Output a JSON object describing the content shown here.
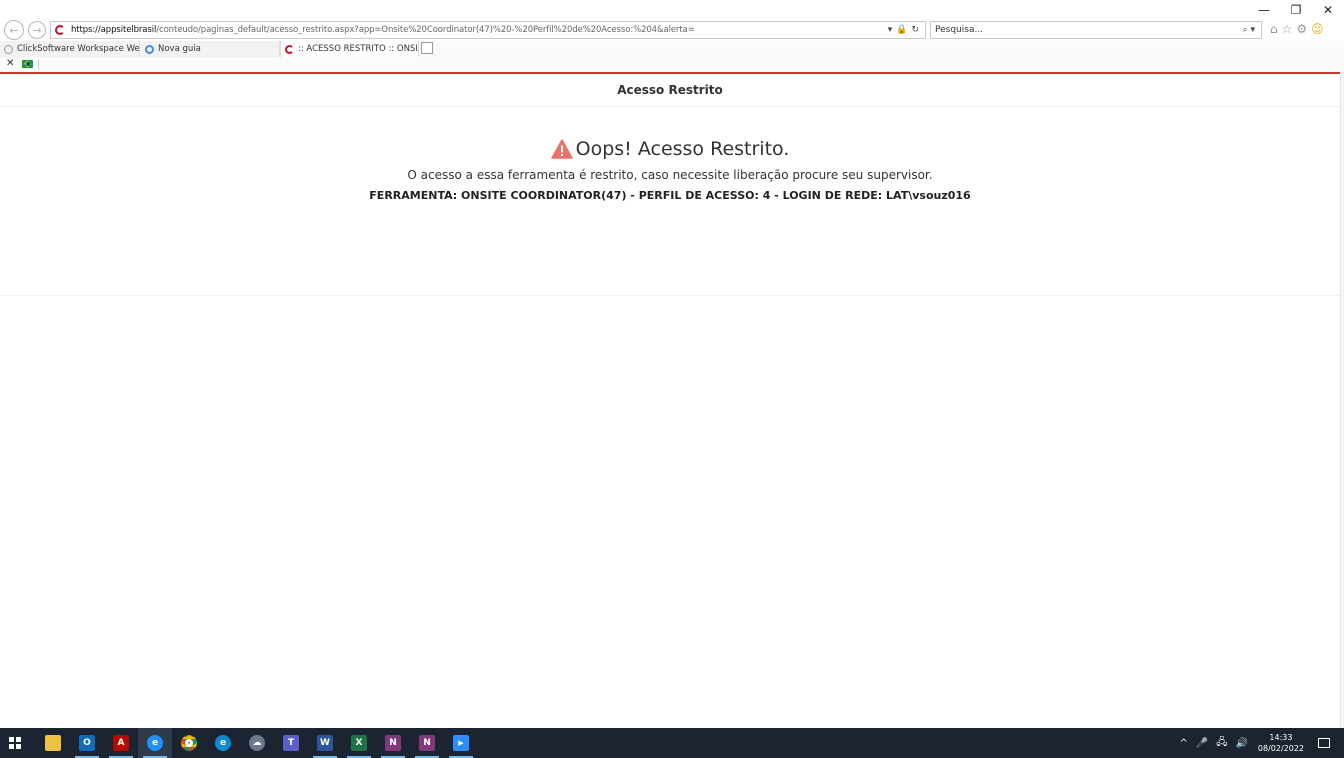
{
  "browser": {
    "window_controls": {
      "minimize": "—",
      "restore": "❐",
      "close": "✕"
    },
    "back_glyph": "←",
    "forward_glyph": "→",
    "url_host": "https://appsitelbrasil",
    "url_rest": "/conteudo/paginas_default/acesso_restrito.aspx?app=Onsite%20Coordinator(47)%20-%20Perfil%20de%20Acesso:%204&alerta=",
    "addr_icons": [
      "▾",
      "🔒",
      "↻"
    ],
    "search_placeholder": "Pesquisa...",
    "search_icons": "⌕ ▾",
    "toolbar_icons": {
      "home": "⌂",
      "favorites": "☆",
      "settings": "⚙",
      "feedback": "☺"
    },
    "tabs": [
      {
        "label": "ClickSoftware Workspace Web ...",
        "icon": "gear-icon",
        "active": false
      },
      {
        "label": "Nova guia",
        "icon": "ie-icon",
        "active": false
      },
      {
        "label": ":: ACESSO RESTRITO :: ONSI...",
        "icon": "site-logo-icon",
        "active": true,
        "close": "✕"
      }
    ],
    "favbar_close": "✕"
  },
  "page": {
    "header_title": "Acesso Restrito",
    "oops_title": "Oops! Acesso Restrito.",
    "description": "O acesso a essa ferramenta é restrito, caso necessite liberação procure seu supervisor.",
    "info": "FERRAMENTA: ONSITE COORDINATOR(47) - PERFIL DE ACESSO: 4 - LOGIN DE REDE: LAT\\vsouz016"
  },
  "colors": {
    "accent_red": "#c0392b",
    "warning": "#e8736a",
    "taskbar": "#1b2430"
  },
  "taskbar": {
    "apps": [
      {
        "name": "file-explorer",
        "glyph": "",
        "bg": "#f0c040",
        "running": false
      },
      {
        "name": "outlook",
        "glyph": "O",
        "bg": "#0f6cbd",
        "running": true
      },
      {
        "name": "adobe-acrobat",
        "glyph": "A",
        "bg": "#b30b00",
        "running": true
      },
      {
        "name": "internet-explorer",
        "glyph": "e",
        "bg": "#1e90ff",
        "running": true,
        "active": true
      },
      {
        "name": "chrome",
        "glyph": "",
        "bg": "#e2b419",
        "running": false
      },
      {
        "name": "edge",
        "glyph": "e",
        "bg": "#0c8bd3",
        "running": false
      },
      {
        "name": "network-app",
        "glyph": "☁",
        "bg": "#6c7a89",
        "running": false
      },
      {
        "name": "teams",
        "glyph": "T",
        "bg": "#5b5fc7",
        "running": false
      },
      {
        "name": "word",
        "glyph": "W",
        "bg": "#2b579a",
        "running": true
      },
      {
        "name": "excel",
        "glyph": "X",
        "bg": "#217346",
        "running": true
      },
      {
        "name": "onenote",
        "glyph": "N",
        "bg": "#80397b",
        "running": true
      },
      {
        "name": "onenote-2016",
        "glyph": "N",
        "bg": "#80397b",
        "running": true
      },
      {
        "name": "zoom",
        "glyph": "▶",
        "bg": "#2d8cff",
        "running": true
      }
    ],
    "tray_icons": {
      "chevron": "^",
      "mic": "🎤",
      "network": "🖧",
      "volume": "🔊"
    },
    "time": "14:33",
    "date": "08/02/2022"
  }
}
